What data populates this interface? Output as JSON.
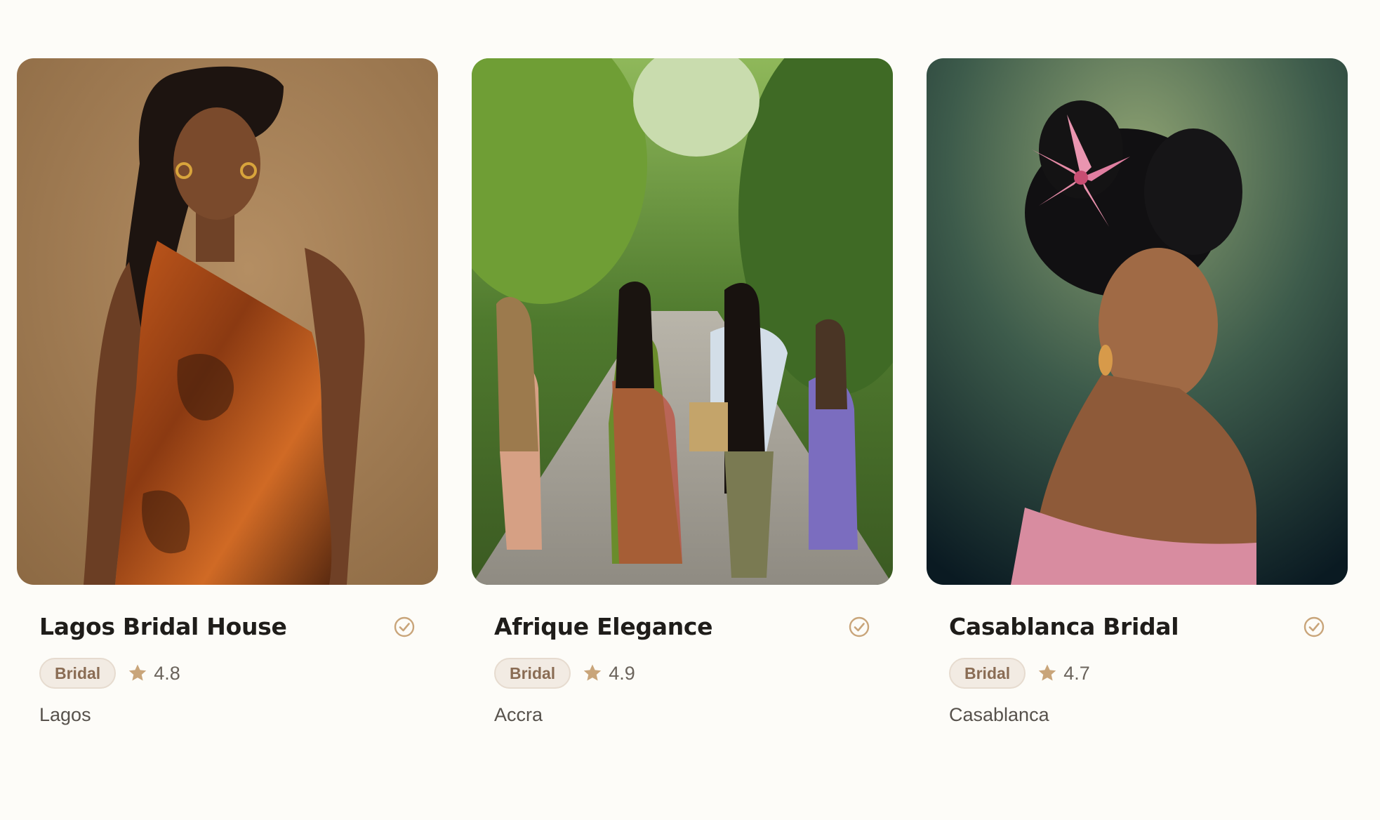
{
  "cards": [
    {
      "name": "Lagos Bridal House",
      "category": "Bridal",
      "rating": "4.8",
      "location": "Lagos",
      "photo_icon": "woman-orange-dress-photo",
      "verified_icon": "verified-check-icon"
    },
    {
      "name": "Afrique Elegance",
      "category": "Bridal",
      "rating": "4.9",
      "location": "Accra",
      "photo_icon": "women-walking-forest-path-photo",
      "verified_icon": "verified-check-icon"
    },
    {
      "name": "Casablanca Bridal",
      "category": "Bridal",
      "rating": "4.7",
      "location": "Casablanca",
      "photo_icon": "woman-pink-lily-hair-photo",
      "verified_icon": "verified-check-icon"
    }
  ],
  "colors": {
    "background": "#fdfcf8",
    "accent": "#c9a57a",
    "badge_bg": "#f2ebe3",
    "badge_text": "#8a6c54"
  }
}
